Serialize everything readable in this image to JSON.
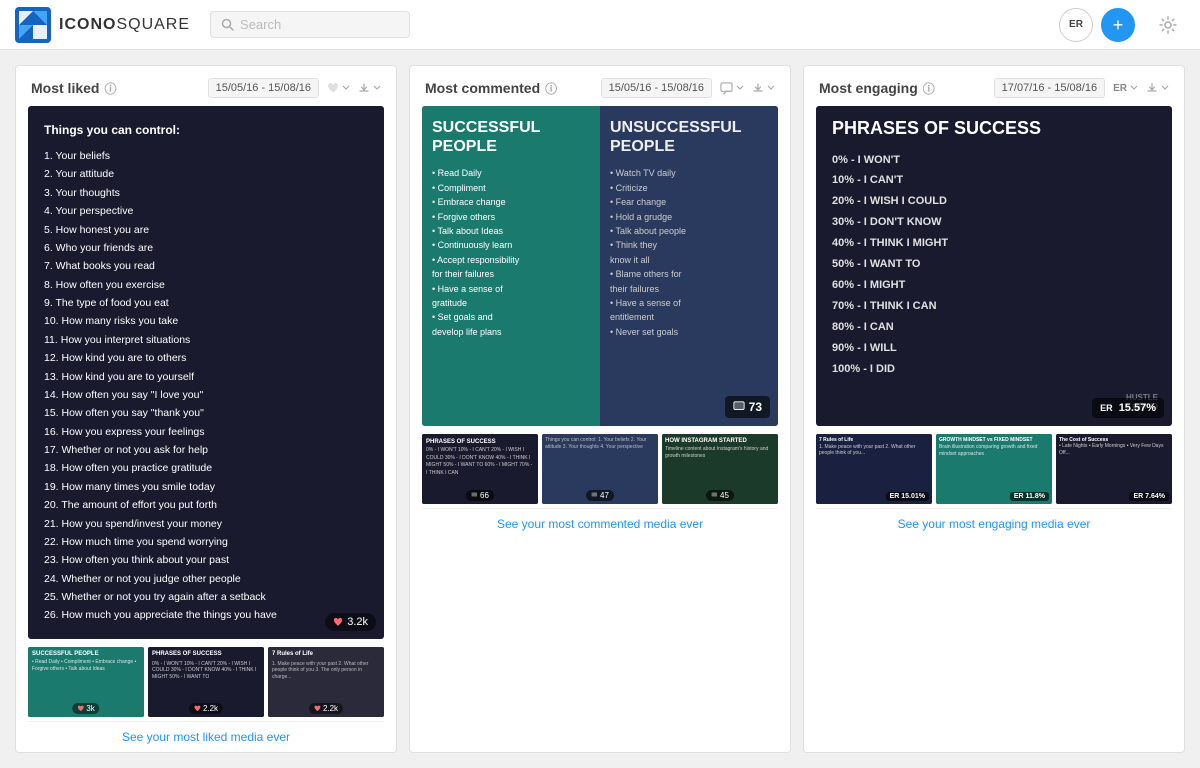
{
  "header": {
    "logo_text_normal": "ICONO",
    "logo_text_bold": "SQUARE",
    "search_placeholder": "Search",
    "add_label": "+",
    "avatar_label": "ER"
  },
  "cards": [
    {
      "id": "most-liked",
      "title": "Most liked",
      "date": "15/05/16 - 15/08/16",
      "main_badge": "3.2k",
      "main_content": {
        "type": "text-list",
        "heading": "Things you can control:",
        "items": [
          "1. Your beliefs",
          "2. Your attitude",
          "3. Your thoughts",
          "4. Your perspective",
          "5. How honest you are",
          "6. Who your friends are",
          "7. What books you read",
          "8. How often you exercise",
          "9. The type of food you eat",
          "10. How many risks you take",
          "11. How you interpret situations",
          "12. How kind you are to others",
          "13. How kind you are to yourself",
          "14. How often you say \"I love you\"",
          "15. How often you say \"thank you\"",
          "16. How you express your feelings",
          "17. Whether or not you ask for help",
          "18. How often you practice gratitude",
          "19. How many times you smile today",
          "20. The amount of effort you put forth",
          "21. How you spend/invest your money",
          "22. How much time you spend worrying",
          "23. How often you think about your past",
          "24. Whether or not you judge other people",
          "25. Whether or not you try again after a setback",
          "26. How much you appreciate the things you have"
        ]
      },
      "thumbnails": [
        {
          "type": "teal",
          "badge_type": "heart",
          "badge_value": "3k"
        },
        {
          "type": "dark",
          "badge_type": "heart",
          "badge_value": "2.2k"
        },
        {
          "type": "dark2",
          "badge_type": "heart",
          "badge_value": "2.2k"
        }
      ],
      "see_more": "See your most liked media ever"
    },
    {
      "id": "most-commented",
      "title": "Most commented",
      "date": "15/05/16 - 15/08/16",
      "main_badge": "73",
      "main_content": {
        "type": "split",
        "left_title": "SUCCESSFUL PEOPLE",
        "left_items": [
          "• Read Daily",
          "• Compliment",
          "• Embrace change",
          "• Forgive others",
          "• Talk about Ideas",
          "• Continuously learn",
          "• Accept responsibility",
          "  for their failures",
          "• Have a sense of",
          "  gratitude",
          "• Set goals and",
          "  develop life plans"
        ],
        "right_title": "UNSUCCESSFUL PEOPLE",
        "right_items": [
          "• Watch TV daily",
          "• Criticize",
          "• Fear change",
          "• Hold a grudge",
          "• Talk about people",
          "• Think they",
          "  know it all",
          "• Blame others for",
          "  their failures",
          "• Have a sense of",
          "  entitlement",
          "• Never set goals"
        ]
      },
      "thumbnails": [
        {
          "type": "dark",
          "badge_type": "comment",
          "badge_value": "66"
        },
        {
          "type": "teal",
          "badge_type": "comment",
          "badge_value": "47"
        },
        {
          "type": "dark2",
          "badge_type": "comment",
          "badge_value": "45"
        }
      ],
      "see_more": "See your most commented media ever"
    },
    {
      "id": "most-engaging",
      "title": "Most engaging",
      "date": "17/07/16 - 15/08/16",
      "main_badge": "15.57%",
      "main_badge_type": "er",
      "main_content": {
        "type": "phrases",
        "title": "PHRASES OF SUCCESS",
        "items": [
          "0% - I WON'T",
          "10% - I CAN'T",
          "20% - I WISH I COULD",
          "30% - I DON'T KNOW",
          "40% - I THINK I MIGHT",
          "50% - I WANT TO",
          "60% - I MIGHT",
          "70% - I THINK I CAN",
          "80% - I CAN",
          "90% - I WILL",
          "100% - I DID"
        ]
      },
      "thumbnails": [
        {
          "type": "navy",
          "badge_type": "er",
          "badge_value": "15.01%"
        },
        {
          "type": "teal",
          "badge_type": "er",
          "badge_value": "11.8%"
        },
        {
          "type": "dark2",
          "badge_type": "er",
          "badge_value": "7.64%"
        }
      ],
      "see_more": "See your most engaging media ever"
    }
  ]
}
